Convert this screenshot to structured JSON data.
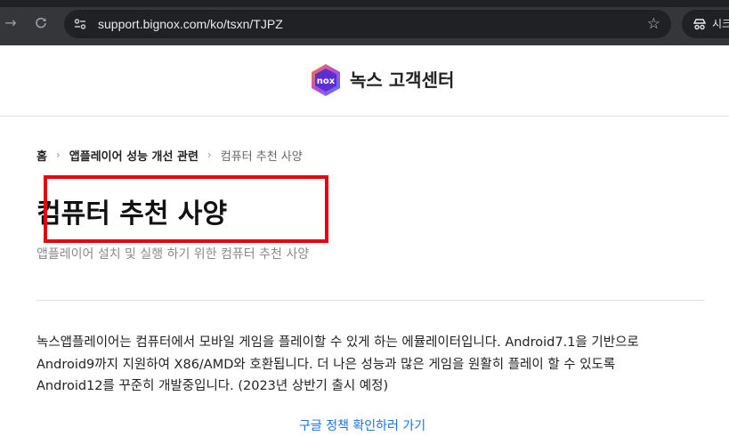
{
  "browser": {
    "url": "support.bignox.com/ko/tsxn/TJPZ",
    "profile_label": "시크릿"
  },
  "header": {
    "logo_icon": "nox-logo-icon",
    "title": "녹스 고객센터"
  },
  "breadcrumb": {
    "home": "홈",
    "category": "앱플레이어 성능 개선 관련",
    "current": "컴퓨터 추천 사양",
    "separator": "›"
  },
  "article": {
    "title": "컴퓨터 추천 사양",
    "subtitle": "앱플레이어 설치 및 실행 하기 위한 컴퓨터 추천 사양",
    "body_lines": [
      "녹스앱플레이어는 컴퓨터에서 모바일 게임을 플레이할 수 있게 하는 에뮬레이터입니다. Android7.1을 기반으로",
      "Android9까지 지원하여 X86/AMD와 호환됩니다. 더 나은 성능과 많은 게임을 원활히 플레이 할 수 있도록",
      "Android12를 꾸준히 개발중입니다. (2023년 상반기 출시 예정)"
    ],
    "policy_link": "구글 정책 확인하러 가기"
  },
  "colors": {
    "highlight": "#e60012",
    "link": "#1a73e8"
  }
}
